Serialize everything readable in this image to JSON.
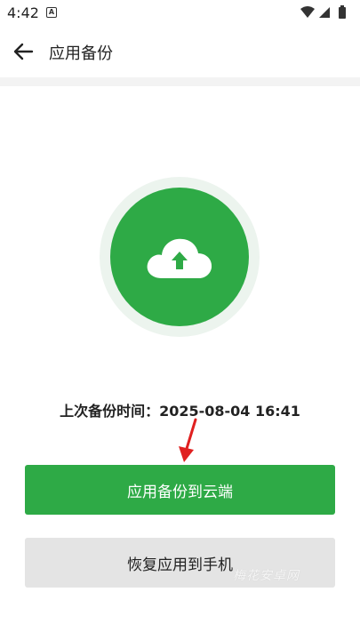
{
  "status_bar": {
    "time": "4:42",
    "notification_badge": "A",
    "icons": [
      "wifi-icon",
      "signal-icon",
      "battery-icon"
    ]
  },
  "header": {
    "title": "应用备份",
    "back_icon": "arrow-left-icon"
  },
  "main": {
    "hero_icon": "cloud-upload-icon",
    "last_backup_label": "上次备份时间：",
    "last_backup_value": "2025-08-04 16:41",
    "primary_button_label": "应用备份到云端",
    "secondary_button_label": "恢复应用到手机"
  },
  "watermark": "梅花安卓网",
  "colors": {
    "accent": "#2eaa46",
    "secondary_button": "#e4e4e4",
    "annotation_arrow": "#e02020"
  }
}
